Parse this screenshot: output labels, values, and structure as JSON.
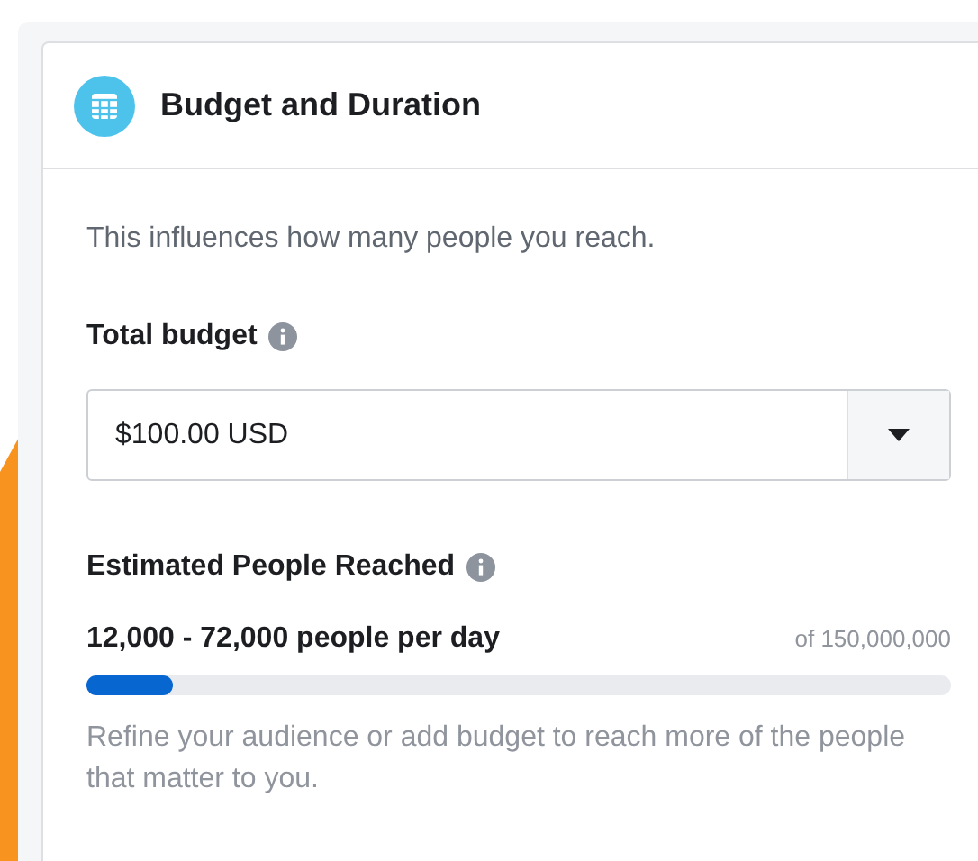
{
  "card": {
    "title": "Budget and Duration",
    "description": "This influences how many people you reach.",
    "budget": {
      "label": "Total budget",
      "value": "$100.00 USD"
    },
    "reach": {
      "label": "Estimated People Reached",
      "estimate": "12,000 - 72,000 people per day",
      "total": "of 150,000,000",
      "level": 0.1,
      "hint": "Refine your audience or add budget to reach more of the people that matter to you."
    }
  }
}
